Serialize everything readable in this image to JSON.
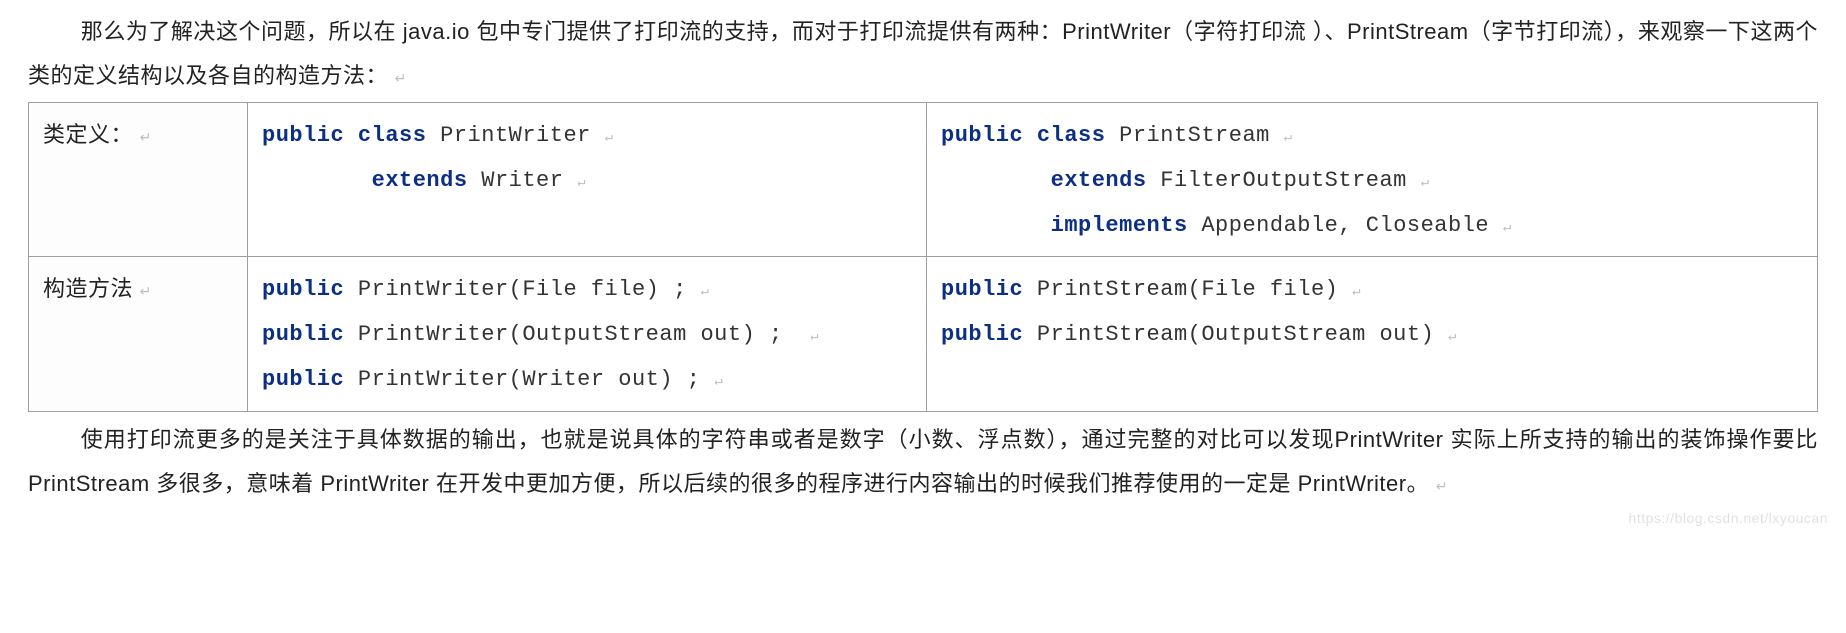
{
  "para1": "那么为了解决这个问题，所以在 java.io 包中专门提供了打印流的支持，而对于打印流提供有两种：PrintWriter（字符打印流 ）、PrintStream（字节打印流），来观察一下这两个类的定义结构以及各自的构造方法：",
  "table": {
    "row1_label": "类定义：",
    "row2_label": "构造方法",
    "r1c1": {
      "l1_kw1": "public",
      "l1_kw2": "class",
      "l1_id": "PrintWriter",
      "l2_kw": "extends",
      "l2_id": "Writer"
    },
    "r1c2": {
      "l1_kw1": "public",
      "l1_kw2": "class",
      "l1_id": "PrintStream",
      "l2_kw": "extends",
      "l2_id": "FilterOutputStream",
      "l3_kw": "implements",
      "l3_id": "Appendable, Closeable"
    },
    "r2c1": {
      "l1_kw": "public",
      "l1_rest": "PrintWriter(File file) ;",
      "l2_kw": "public",
      "l2_rest": "PrintWriter(OutputStream out) ;",
      "l3_kw": "public",
      "l3_rest": "PrintWriter(Writer out) ;"
    },
    "r2c2": {
      "l1_kw": "public",
      "l1_rest": "PrintStream(File file)",
      "l2_kw": "public",
      "l2_rest": "PrintStream(OutputStream out)"
    }
  },
  "para2": "使用打印流更多的是关注于具体数据的输出，也就是说具体的字符串或者是数字（小数、浮点数），通过完整的对比可以发现PrintWriter 实际上所支持的输出的装饰操作要比 PrintStream 多很多，意味着 PrintWriter 在开发中更加方便，所以后续的很多的程序进行内容输出的时候我们推荐使用的一定是 PrintWriter。",
  "watermark": "https://blog.csdn.net/lxyoucan",
  "marks": {
    "crlf": "↵",
    "enter": "↵",
    "dot": "。"
  }
}
